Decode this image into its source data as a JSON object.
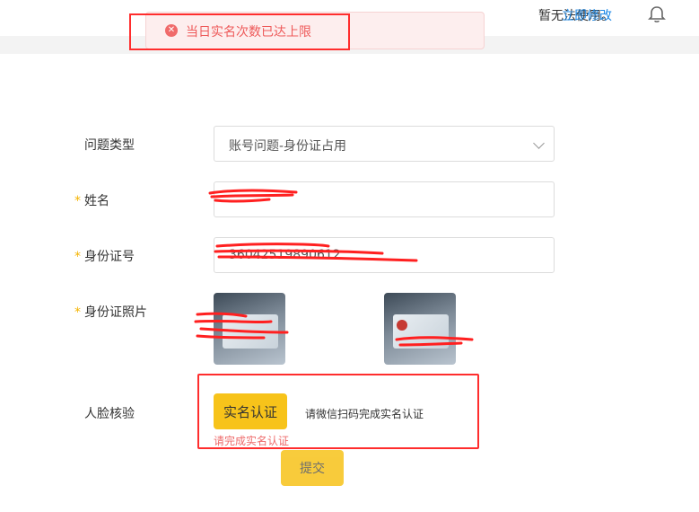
{
  "header": {
    "notice_tail": "暂无法使用。",
    "notice_link": "立即修改",
    "bell_icon": "bell-icon"
  },
  "toast": {
    "icon": "close-circle-icon",
    "message": "当日实名次数已达上限"
  },
  "form": {
    "issue_type": {
      "label": "问题类型",
      "value": "账号问题-身份证占用"
    },
    "name": {
      "label": "姓名",
      "required_mark": "*"
    },
    "id_number": {
      "label": "身份证号",
      "required_mark": "*",
      "value": "36042519890612"
    },
    "id_photos": {
      "label": "身份证照片",
      "required_mark": "*"
    },
    "face_verify": {
      "label": "人脸核验",
      "button_label": "实名认证",
      "hint": "请微信扫码完成实名认证",
      "error": "请完成实名认证"
    },
    "submit_label": "提交"
  },
  "colors": {
    "accent_yellow": "#f7c31a",
    "error_red": "#ee5a5a",
    "link_blue": "#1e88e5",
    "annotation_red": "#ff2d2d"
  }
}
